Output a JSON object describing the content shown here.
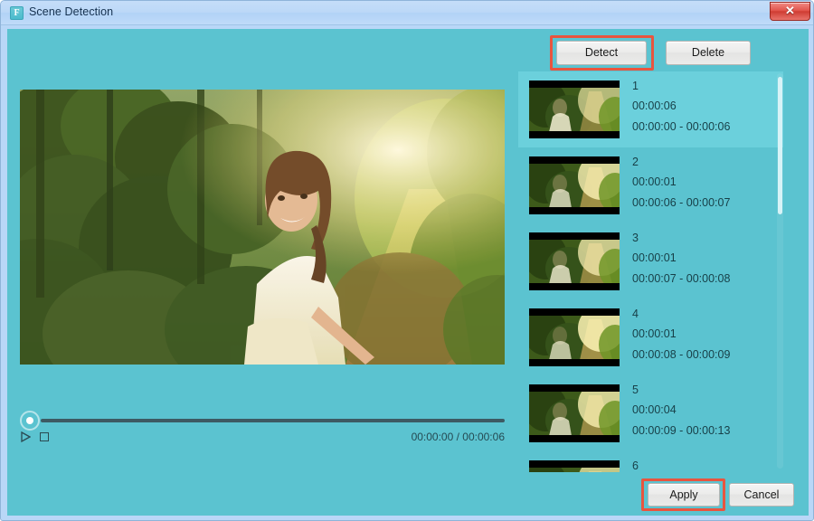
{
  "window": {
    "title": "Scene Detection",
    "app_icon": "F",
    "close_label": "✕",
    "accent_teal": "#5bc3d0",
    "highlight_red": "#e8553f",
    "titlebar_blue": "#bcd8f7"
  },
  "toolbar": {
    "detect_label": "Detect",
    "delete_label": "Delete"
  },
  "footer": {
    "apply_label": "Apply",
    "cancel_label": "Cancel"
  },
  "player": {
    "play_icon": "play-icon",
    "stop_icon": "stop-icon",
    "current_time": "00:00:00",
    "total_time": "00:00:06",
    "timecode": "00:00:00 / 00:00:06",
    "progress_percent": 0
  },
  "scene_list": {
    "selected_index": 1,
    "scenes": [
      {
        "index": "1",
        "duration": "00:00:06",
        "range": "00:00:00 - 00:00:06",
        "selected": true
      },
      {
        "index": "2",
        "duration": "00:00:01",
        "range": "00:00:06 - 00:00:07",
        "selected": false
      },
      {
        "index": "3",
        "duration": "00:00:01",
        "range": "00:00:07 - 00:00:08",
        "selected": false
      },
      {
        "index": "4",
        "duration": "00:00:01",
        "range": "00:00:08 - 00:00:09",
        "selected": false
      },
      {
        "index": "5",
        "duration": "00:00:04",
        "range": "00:00:09 - 00:00:13",
        "selected": false
      },
      {
        "index": "6",
        "duration": "",
        "range": "",
        "selected": false
      }
    ]
  }
}
